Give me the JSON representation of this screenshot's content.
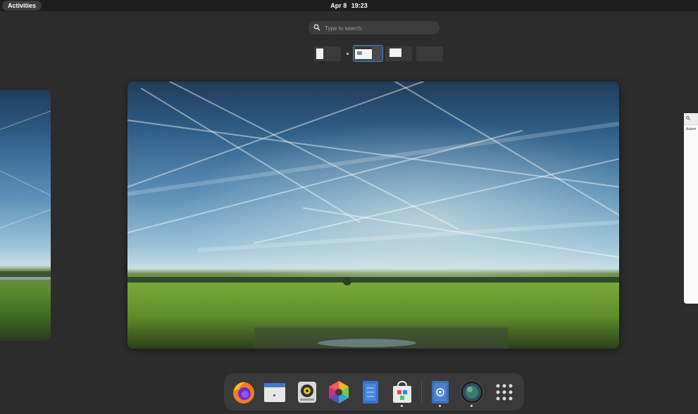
{
  "top_bar": {
    "activities_label": "Activities",
    "date": "Apr 8",
    "time": "19:23"
  },
  "search": {
    "placeholder": "Type to search",
    "icon": "search-icon"
  },
  "workspaces": [
    {
      "label": "workspace-1",
      "active": false
    },
    {
      "label": "workspace-2",
      "active": true
    },
    {
      "label": "workspace-3",
      "active": false
    },
    {
      "label": "workspace-4",
      "active": false
    }
  ],
  "side_window": {
    "partial_label": "Autom"
  },
  "dock": {
    "items": [
      {
        "name": "firefox-icon",
        "running": false
      },
      {
        "name": "window-app-icon",
        "running": false
      },
      {
        "name": "sound-recorder-icon",
        "running": false
      },
      {
        "name": "color-palette-icon",
        "running": false
      },
      {
        "name": "document-editor-icon",
        "running": false
      },
      {
        "name": "software-store-icon",
        "running": true
      },
      {
        "name": "mail-client-icon",
        "running": true
      },
      {
        "name": "camera-lens-icon",
        "running": true
      },
      {
        "name": "app-grid-icon",
        "running": false
      }
    ]
  },
  "colors": {
    "accent": "#3584e4",
    "panel": "#1e1e1e",
    "background": "#2c2c2c",
    "dock": "#3a3a3a"
  }
}
